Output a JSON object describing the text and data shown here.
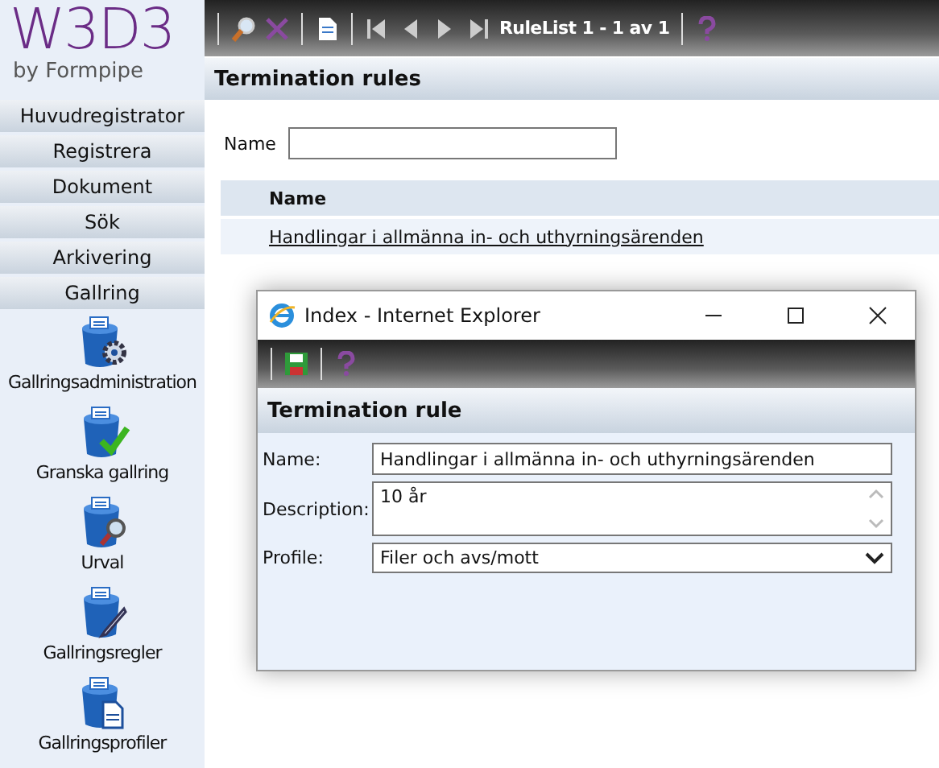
{
  "logo": {
    "title": "W3D3",
    "subtitle": "by Formpipe"
  },
  "sidebar": {
    "menu": [
      "Huvudregistrator",
      "Registrera",
      "Dokument",
      "Sök",
      "Arkivering",
      "Gallring"
    ],
    "items": [
      {
        "label": "Gallringsadministration",
        "kind": "gear"
      },
      {
        "label": "Granska gallring",
        "kind": "check"
      },
      {
        "label": "Urval",
        "kind": "magnifier"
      },
      {
        "label": "Gallringsregler",
        "kind": "pen"
      },
      {
        "label": "Gallringsprofiler",
        "kind": "document"
      }
    ]
  },
  "toolbar": {
    "pager": "RuleList 1 - 1 av 1"
  },
  "page": {
    "title": "Termination rules",
    "filter_label": "Name"
  },
  "table": {
    "columns": [
      "Name"
    ],
    "rows": [
      [
        "Handlingar i allmänna in- och uthyrningsärenden"
      ]
    ]
  },
  "popup": {
    "title": "Index - Internet Explorer",
    "heading": "Termination rule",
    "fields": [
      {
        "label": "Name:",
        "kind": "text",
        "value": "Handlingar i allmänna in- och uthyrningsärenden"
      },
      {
        "label": "Description:",
        "kind": "textarea",
        "value": "10 år"
      },
      {
        "label": "Profile:",
        "kind": "select",
        "value": "Filer och avs/mott"
      }
    ]
  }
}
